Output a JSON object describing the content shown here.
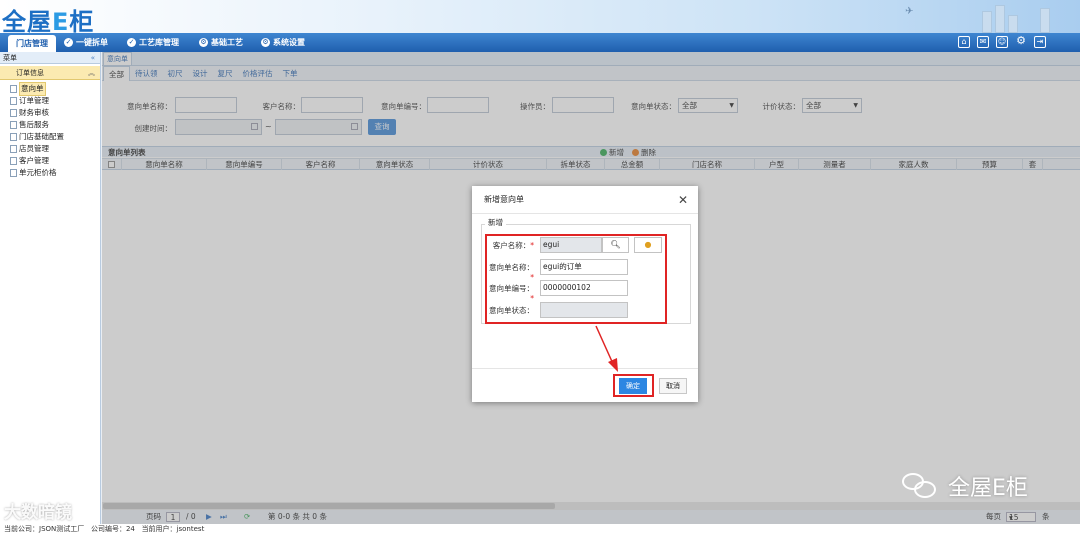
{
  "app": {
    "logo_main": "全屋",
    "logo_e": "E",
    "logo_end": "柜"
  },
  "nav": {
    "items": [
      {
        "label": "门店管理",
        "icon": "none"
      },
      {
        "label": "一键拆单",
        "icon": "check-circle-icon"
      },
      {
        "label": "工艺库管理",
        "icon": "check-circle-icon"
      },
      {
        "label": "基础工艺",
        "icon": "gear-icon"
      },
      {
        "label": "系统设置",
        "icon": "gear-icon"
      }
    ],
    "tool_icons": [
      "home-icon",
      "message-icon",
      "user-icon",
      "settings-icon",
      "exit-icon"
    ]
  },
  "sidebar": {
    "header": "菜单",
    "group": "订单信息",
    "items": [
      "意向单",
      "订单管理",
      "财务审核",
      "售后服务",
      "门店基础配置",
      "店员管理",
      "客户管理",
      "单元柜价格"
    ]
  },
  "content": {
    "tab": "意向单",
    "subtabs": [
      "全部",
      "待认领",
      "初尺",
      "设计",
      "复尺",
      "价格评估",
      "下单"
    ],
    "filters": {
      "intent_name": "意向单名称：",
      "customer_name": "客户名称：",
      "intent_no": "意向单编号：",
      "operator": "操作员：",
      "intent_status": "意向单状态：",
      "intent_status_value": "全部",
      "price_status": "计价状态：",
      "price_status_value": "全部",
      "create_time": "创建时间：",
      "range_sep": "~",
      "query": "查询"
    },
    "grid": {
      "title": "意向单列表",
      "add": "新增",
      "delete": "删除",
      "columns": [
        "意向单名称",
        "意向单编号",
        "客户名称",
        "意向单状态",
        "计价状态",
        "拆单状态",
        "总金额",
        "门店名称",
        "户型",
        "测量者",
        "家庭人数",
        "预算",
        "套"
      ]
    },
    "pager": {
      "page_label": "页码",
      "page": "1",
      "of": "/ 0",
      "info": "第 0-0 条  共 0 条",
      "per_page_label": "每页",
      "per_page": "15",
      "unit": "条"
    }
  },
  "dialog": {
    "title": "新增意向单",
    "legend": "新增",
    "customer_label": "客户名称：",
    "customer_value": "egui",
    "intent_name_label": "意向单名称：",
    "intent_name_value": "egui的订单",
    "intent_no_label": "意向单编号：",
    "intent_no_value": "0000000102",
    "intent_status_label": "意向单状态：",
    "required_mark": "*",
    "ok": "确定",
    "cancel": "取消"
  },
  "footer": {
    "company": "当前公司：JSON测试工厂",
    "company_no": "公司编号：24",
    "user": "当前用户：jsontest"
  },
  "watermarks": {
    "left": "大数暗镜",
    "right": "全屋E柜"
  },
  "colors": {
    "nav_blue": "#1f5fae",
    "highlight_red": "#e02424",
    "ok_blue": "#2c86e2",
    "active_yellow": "#fbeab1"
  }
}
